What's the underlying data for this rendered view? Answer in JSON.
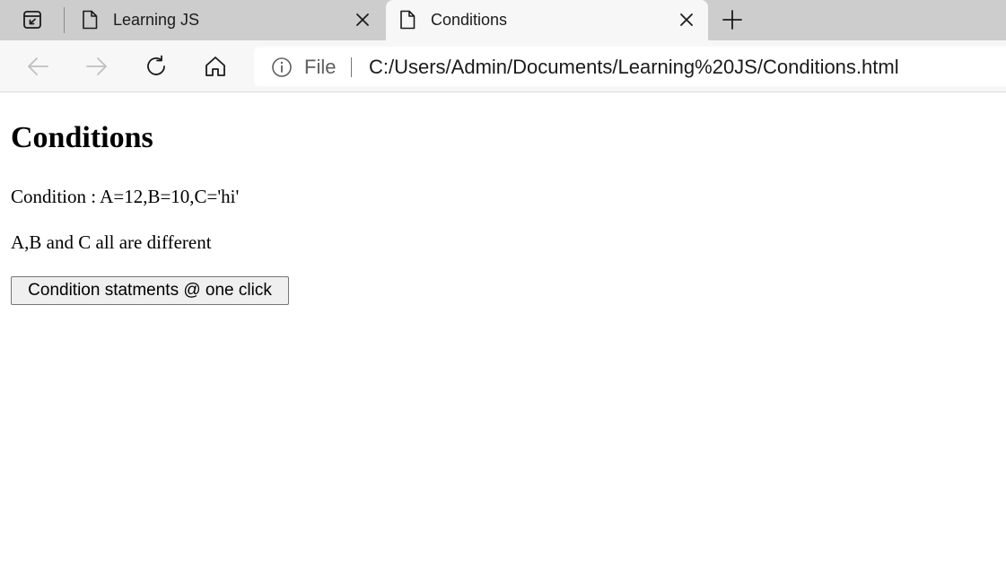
{
  "browser": {
    "tabs": [
      {
        "title": "Learning JS",
        "active": false,
        "icon": "page-icon"
      },
      {
        "title": "Conditions",
        "active": true,
        "icon": "page-icon"
      }
    ],
    "address_bar": {
      "scheme_label": "File",
      "url": "C:/Users/Admin/Documents/Learning%20JS/Conditions.html",
      "icon": "info-icon"
    },
    "toolbar_icons": [
      "back-arrow-icon",
      "forward-arrow-icon",
      "refresh-icon",
      "home-icon"
    ],
    "colors": {
      "tabstrip": "#cdcdcd",
      "active_tab": "#f7f7f7",
      "disabled_icon": "#bfbfbf"
    }
  },
  "page": {
    "heading": "Conditions",
    "condition_text": "Condition : A=12,B=10,C='hi'",
    "result_text": "A,B and C all are different",
    "button_label": "Condition statments @ one click"
  }
}
